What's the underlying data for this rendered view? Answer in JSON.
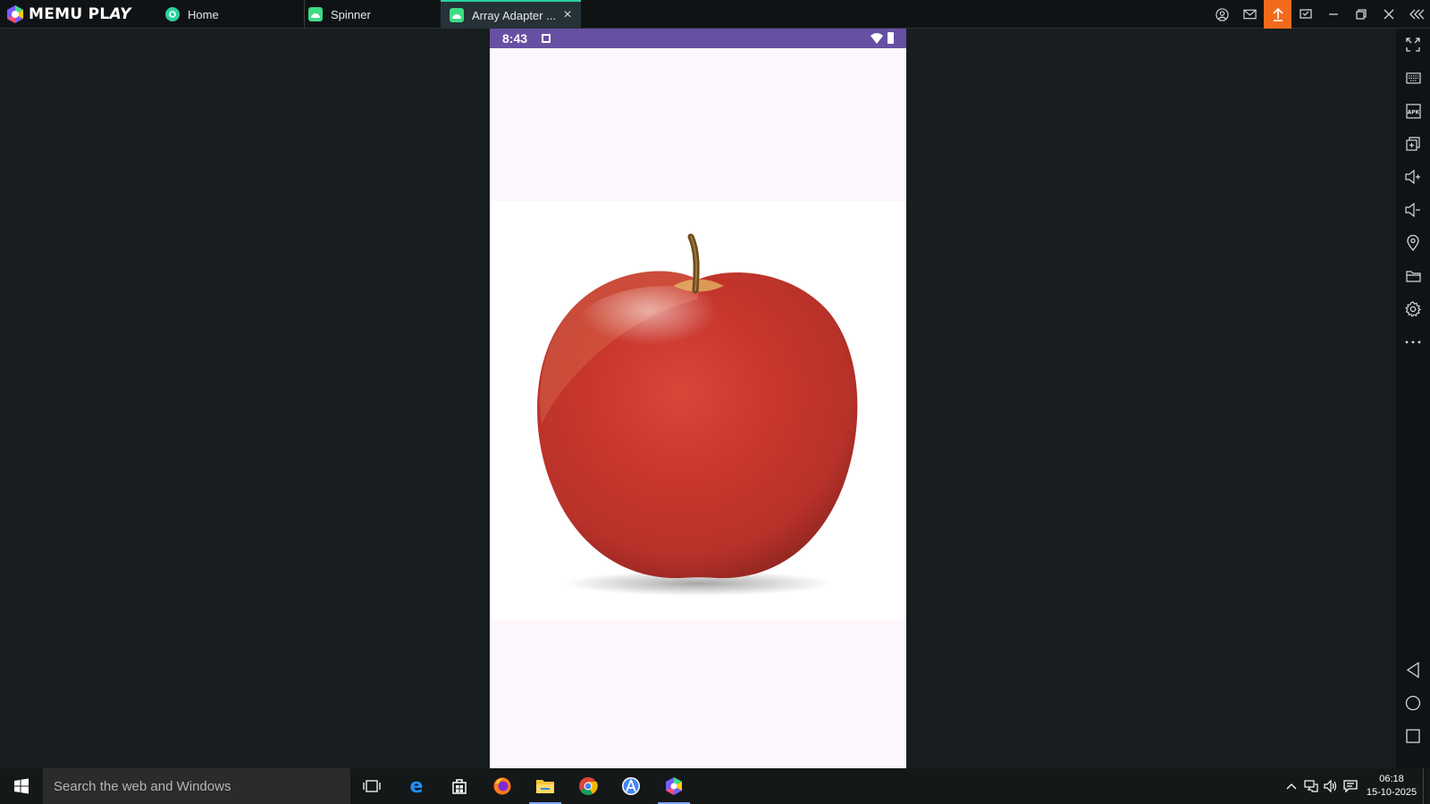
{
  "titlebar": {
    "brand_main": "MEMU PL",
    "brand_play": "AY",
    "tabs": [
      {
        "label": "Home",
        "icon": "memu-home-icon",
        "color": "#2bd0a0"
      },
      {
        "label": "Spinner",
        "icon": "android-app-icon",
        "color": "#3ddc84"
      },
      {
        "label": "Array Adapter ...",
        "icon": "android-app-icon",
        "color": "#3ddc84",
        "active": true
      }
    ],
    "buttons": [
      "account-icon",
      "mail-icon",
      "upload-icon",
      "multi-window-icon",
      "minimize-icon",
      "restore-icon",
      "close-icon",
      "collapse-sidebar-icon"
    ],
    "upload_color": "#f26b1d"
  },
  "phone": {
    "status_time": "8:43",
    "status_bar_color": "#6750a4",
    "background": "#fdf7fd",
    "image_description_icon": "apple-image"
  },
  "sidebar": {
    "items": [
      "fullscreen-icon",
      "keyboard-icon",
      "apk-icon",
      "add-window-icon",
      "volume-up-icon",
      "volume-down-icon",
      "location-icon",
      "folder-icon",
      "settings-icon",
      "more-icon",
      "back-icon",
      "home-icon",
      "recents-icon"
    ],
    "apk_label": "APK"
  },
  "taskbar": {
    "search_placeholder": "Search the web and Windows",
    "apps": [
      "task-view-icon",
      "edge-icon",
      "store-icon",
      "firefox-icon",
      "file-explorer-icon",
      "chrome-icon",
      "android-studio-icon",
      "memu-icon"
    ],
    "clock_time": "06:18",
    "clock_date": "15-10-2025"
  }
}
